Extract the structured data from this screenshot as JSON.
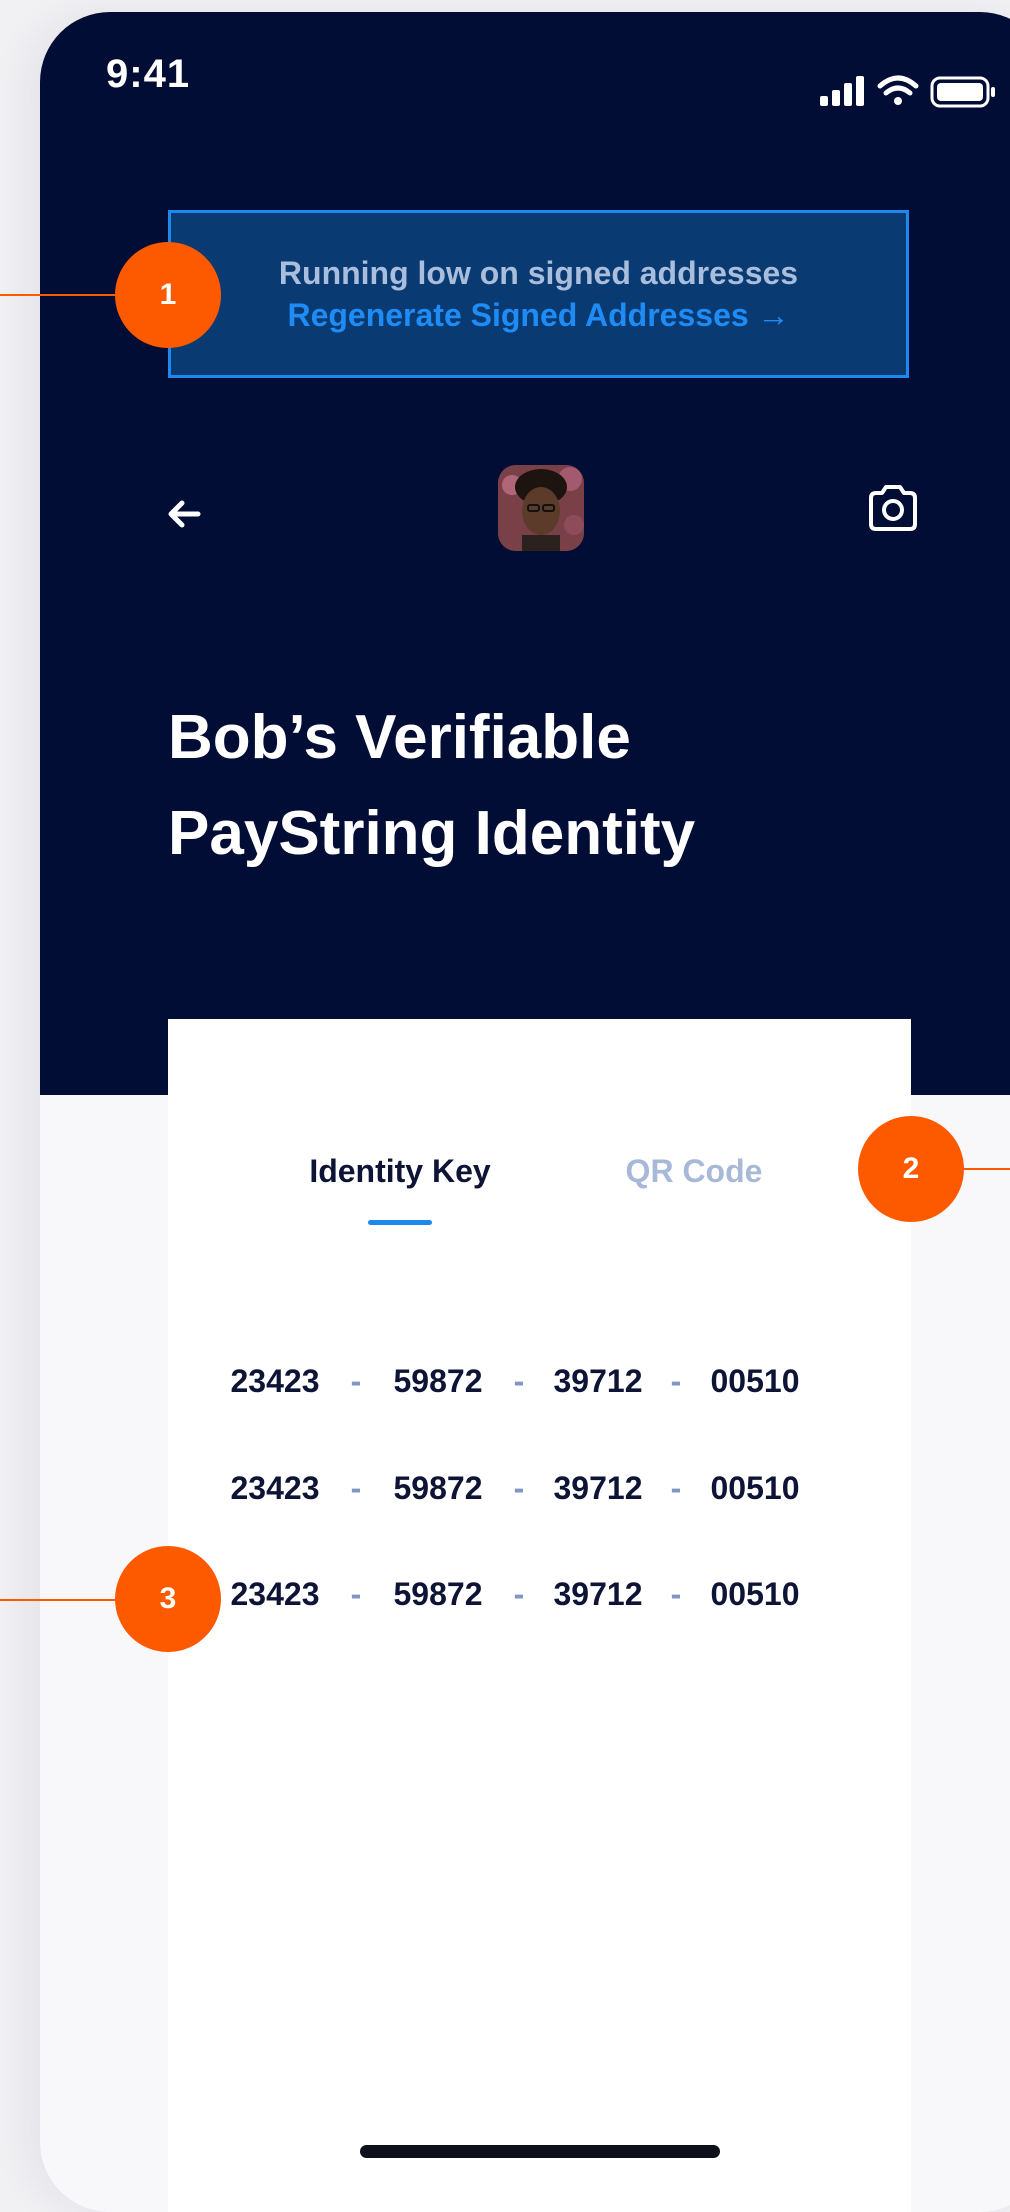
{
  "status_bar": {
    "time": "9:41",
    "icons": [
      "signal-icon",
      "wifi-icon",
      "battery-icon"
    ]
  },
  "banner": {
    "message": "Running low on signed addresses",
    "link": "Regenerate Signed Addresses →"
  },
  "header": {
    "back_icon": "back-arrow-icon",
    "camera_icon": "camera-icon",
    "title_line1": "Bob’s Verifiable",
    "title_line2": "PayString Identity"
  },
  "tabs": [
    {
      "label": "Identity Key",
      "active": true
    },
    {
      "label": "QR Code",
      "active": false
    }
  ],
  "identity_key": {
    "separator": "-",
    "rows": [
      [
        "23423",
        "59872",
        "39712",
        "00510"
      ],
      [
        "23423",
        "59872",
        "39712",
        "00510"
      ],
      [
        "23423",
        "59872",
        "39712",
        "00510"
      ]
    ]
  },
  "callouts": [
    "1",
    "2",
    "3"
  ],
  "colors": {
    "header_bg": "#020d36",
    "accent": "#1f88ee",
    "callout": "#fd5a00",
    "banner_bg": "#0a3a72"
  }
}
